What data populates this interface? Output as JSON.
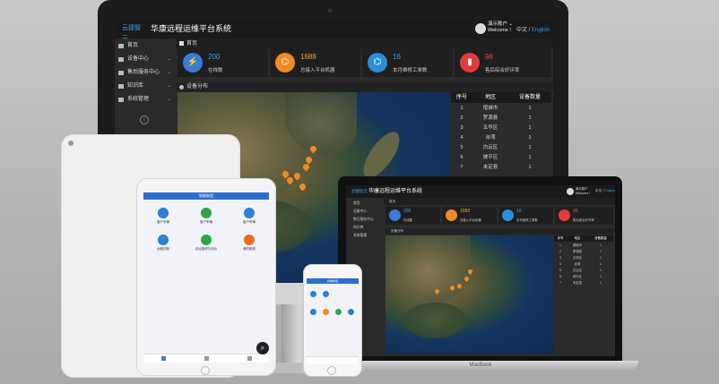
{
  "header": {
    "logo": "云捷智云",
    "title": "华康远程运维平台系统",
    "user_name": "演示账户",
    "user_sub": "Welcome !",
    "lang_cn": "中文",
    "lang_sep": " / ",
    "lang_en": "English"
  },
  "sidebar": {
    "items": [
      {
        "label": "首页",
        "has_chevron": false
      },
      {
        "label": "设备中心",
        "has_chevron": true
      },
      {
        "label": "售后服务中心",
        "has_chevron": true
      },
      {
        "label": "知识库",
        "has_chevron": true
      },
      {
        "label": "系统管理",
        "has_chevron": true
      }
    ],
    "chevron": "⌄",
    "collapse": "‹"
  },
  "breadcrumb": "首页",
  "stats": [
    {
      "value": "200",
      "label": "在线数",
      "color": "#3a7bd5",
      "glyph": "⚡",
      "value_color": "#3a9ee8"
    },
    {
      "value": "1688",
      "label": "总接入平台机器",
      "color": "#f08a24",
      "glyph": "⌬",
      "value_color": "#f0a030"
    },
    {
      "value": "16",
      "label": "本月维修工单数",
      "color": "#2a8ed8",
      "glyph": "⌬",
      "value_color": "#3a9ee8"
    },
    {
      "value": "98",
      "label": "售后综合好评率",
      "color": "#e23b3b",
      "glyph": "▮",
      "value_color": "#e84848"
    }
  ],
  "map_panel": {
    "title": "设备分布"
  },
  "table": {
    "headers": [
      "序号",
      "地区",
      "设备数量"
    ],
    "rows": [
      [
        "1",
        "增城市",
        "1"
      ],
      [
        "2",
        "罗源县",
        "1"
      ],
      [
        "3",
        "五华区",
        "1"
      ],
      [
        "4",
        "台湾",
        "1"
      ],
      [
        "5",
        "白云区",
        "1"
      ],
      [
        "6",
        "坡平区",
        "1"
      ],
      [
        "7",
        "未定县",
        "1"
      ]
    ]
  },
  "ipad": {
    "bar_title": "智能制造",
    "apps": [
      {
        "label": "客户车辆",
        "color": "#2d7fd8"
      },
      {
        "label": "客户车辆",
        "color": "#2fa54a"
      },
      {
        "label": "客户车辆",
        "color": "#2d7fd8"
      },
      {
        "label": "远程诊断",
        "color": "#2d7fd8"
      },
      {
        "label": "自动报修与评价",
        "color": "#2fa54a"
      },
      {
        "label": "我的维修",
        "color": "#f06a24"
      }
    ],
    "zoom_icon": "⌕"
  },
  "phone": {
    "bar_title": "智能制造"
  },
  "macbook": {
    "label": "MacBook"
  },
  "colors": {
    "accent": "#39a0e8",
    "pin": "#f08a24"
  }
}
